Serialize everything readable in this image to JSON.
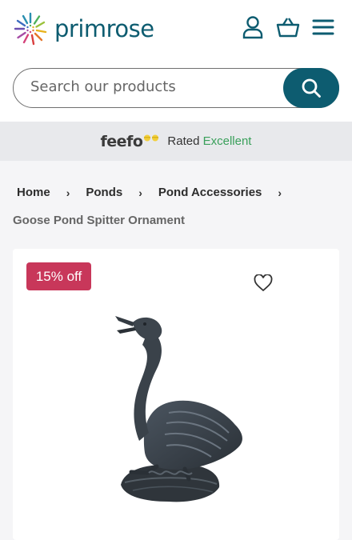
{
  "header": {
    "logo_text": "primrose",
    "icons": [
      "account-icon",
      "basket-icon",
      "menu-icon"
    ]
  },
  "search": {
    "placeholder": "Search our products",
    "button_icon": "search-icon"
  },
  "feefo": {
    "logo": "feefo",
    "rated": "Rated",
    "rating": "Excellent"
  },
  "breadcrumb": {
    "items": [
      "Home",
      "Ponds",
      "Pond Accessories"
    ]
  },
  "product": {
    "name": "Goose Pond Spitter Ornament",
    "badge": "15% off",
    "wishlist_icon": "heart-icon"
  },
  "colors": {
    "brand": "#0d5c70",
    "badge": "#c8375a",
    "rating": "#3aa05b",
    "feefo_bg": "#e8e9ec",
    "content_bg": "#f5f5f7"
  }
}
